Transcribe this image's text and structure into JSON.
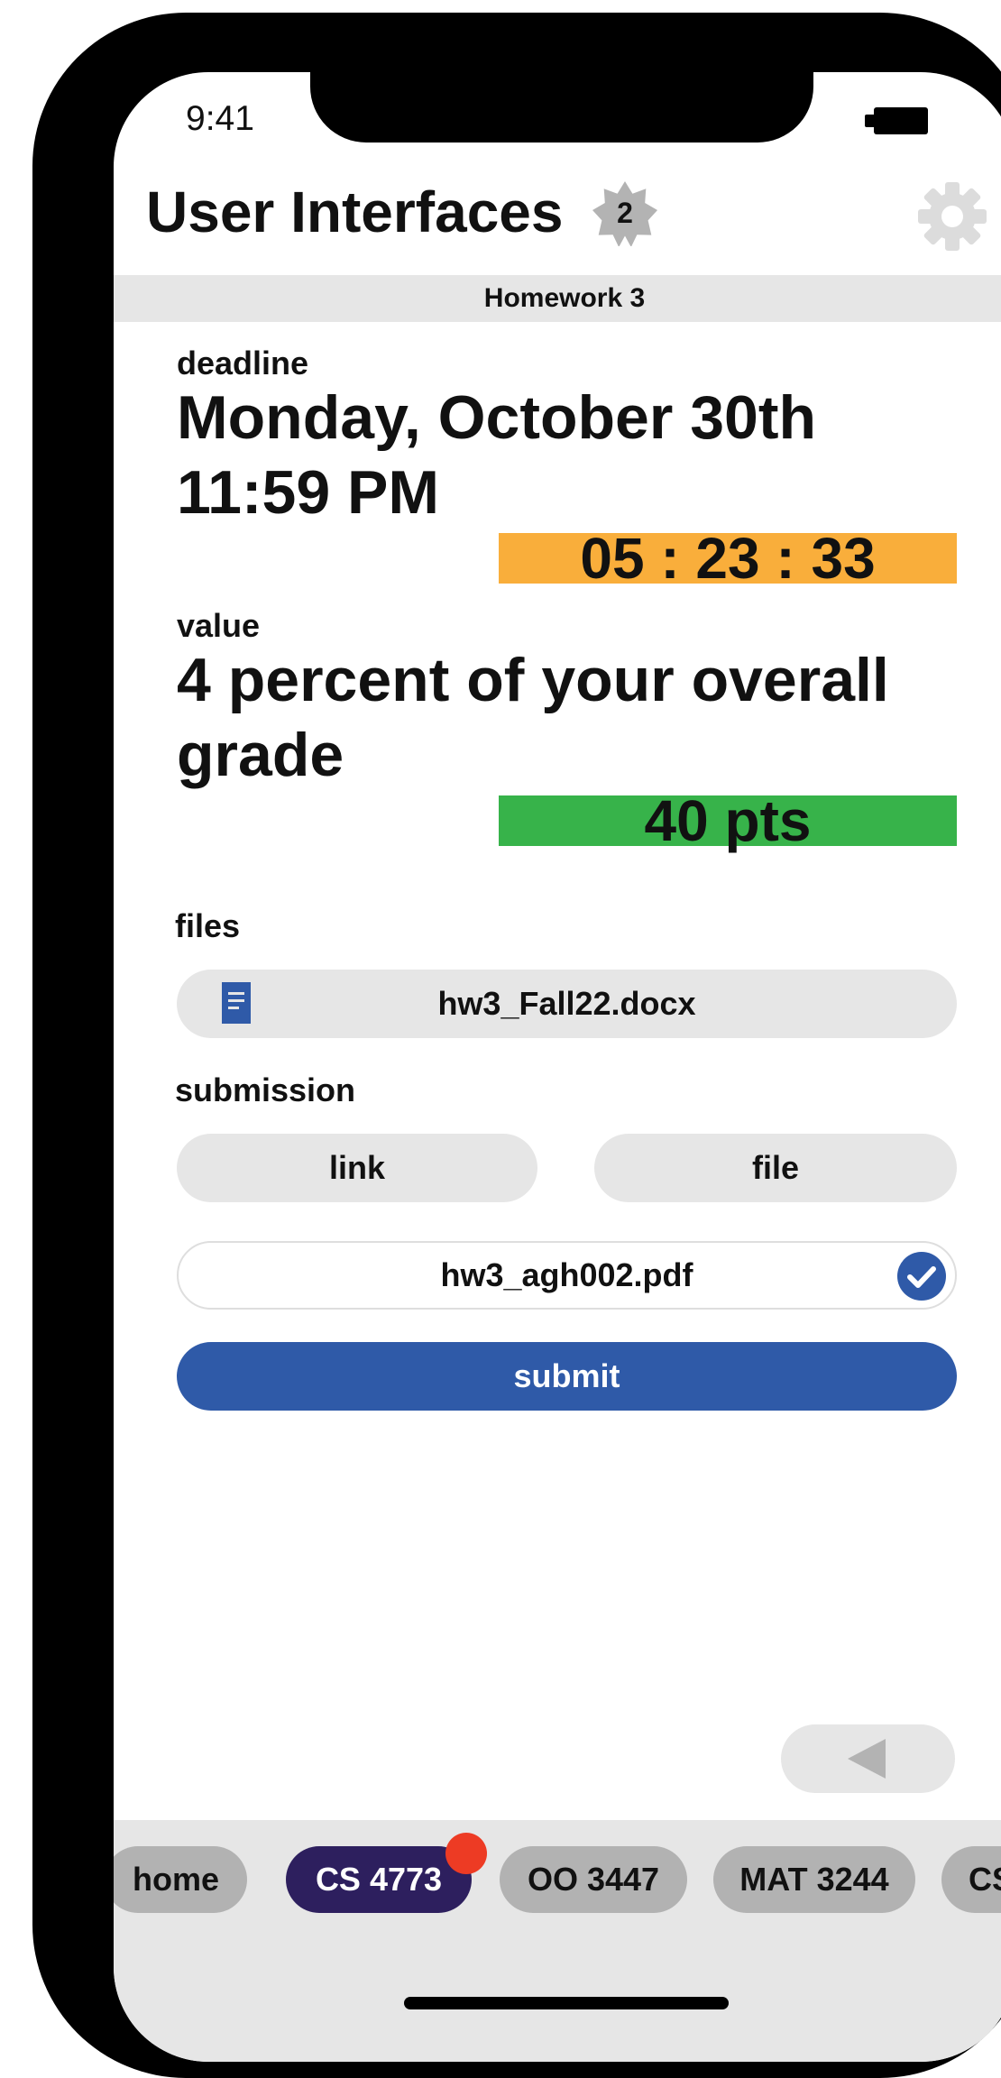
{
  "status": {
    "time": "9:41"
  },
  "header": {
    "title": "User Interfaces",
    "badge_count": "2"
  },
  "assignment": {
    "name": "Homework 3",
    "deadline_label": "deadline",
    "deadline_line1": "Monday, October 30th",
    "deadline_line2": "11:59 PM",
    "countdown": "05 : 23 : 33",
    "value_label": "value",
    "value_line1": "4 percent of your overall",
    "value_line2": "grade",
    "points": "40 pts"
  },
  "files": {
    "label": "files",
    "items": [
      {
        "name": "hw3_Fall22.docx"
      }
    ]
  },
  "submission": {
    "label": "submission",
    "link_button": "link",
    "file_button": "file",
    "selected_file": "hw3_agh002.pdf",
    "submit_button": "submit"
  },
  "tabs": [
    {
      "label": "home",
      "active": false
    },
    {
      "label": "CS 4773",
      "active": true
    },
    {
      "label": "OO 3447",
      "active": false
    },
    {
      "label": "MAT 3244",
      "active": false
    },
    {
      "label": "CS",
      "active": false
    }
  ],
  "colors": {
    "countdown_bg": "#f9ae3b",
    "points_bg": "#37b34a",
    "primary": "#2f5aa8",
    "active_tab": "#2d1f5e",
    "notification": "#ed3b24"
  }
}
